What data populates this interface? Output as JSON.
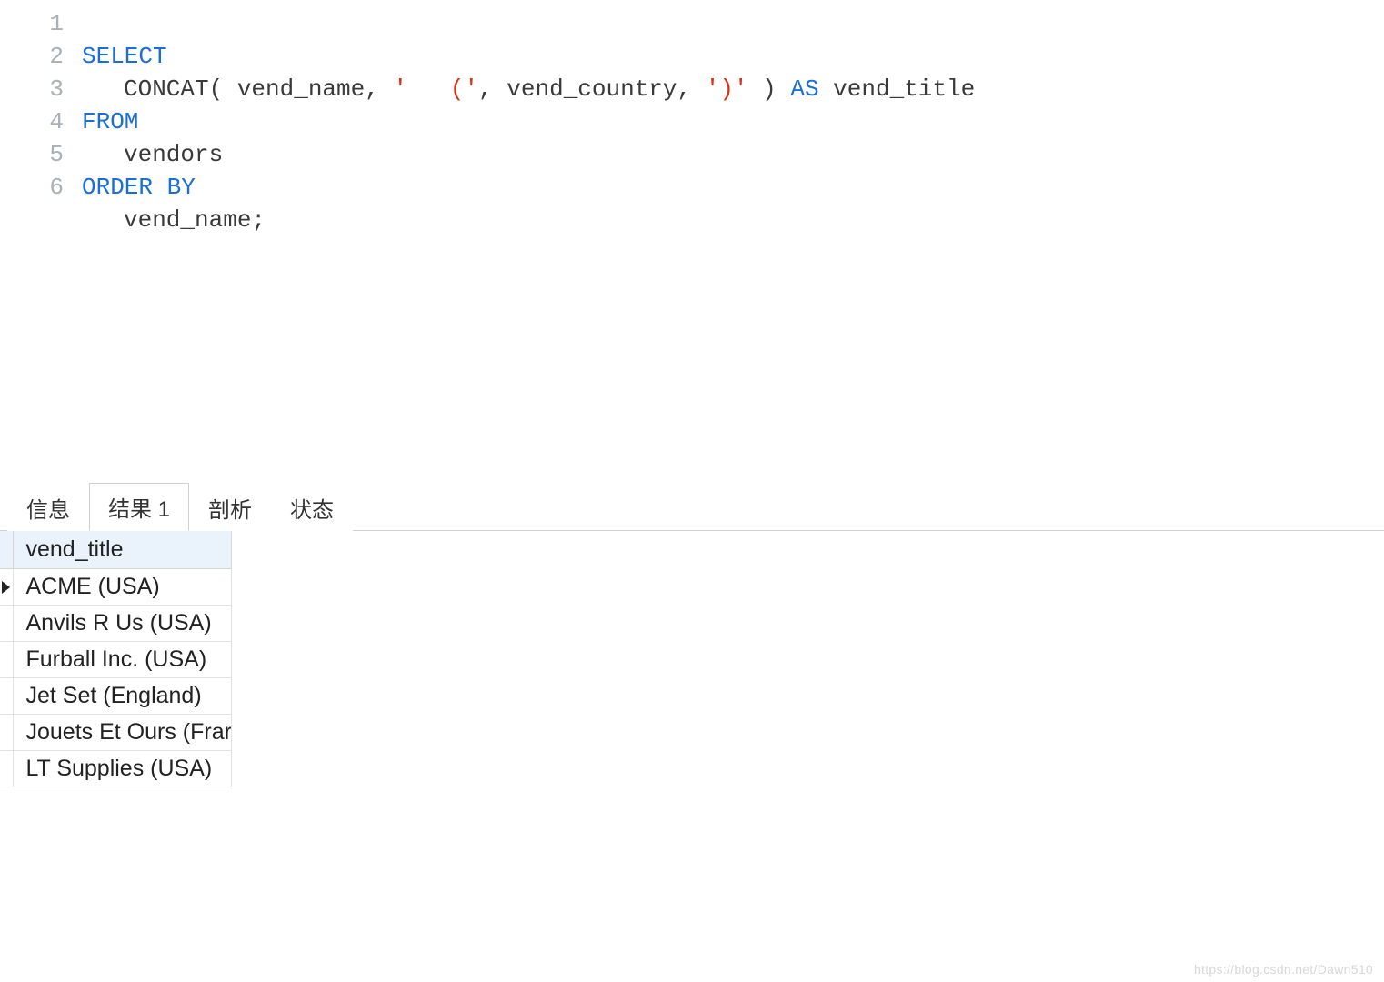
{
  "editor": {
    "lineNumbers": [
      "1",
      "2",
      "3",
      "4",
      "5",
      "6"
    ],
    "tokens": {
      "select": "SELECT",
      "concat": "CONCAT( vend_name, ",
      "str1": "'   ('",
      "comma1": ", vend_country, ",
      "str2": "')'",
      "close": " ) ",
      "as": "AS",
      "alias": " vend_title",
      "from": "FROM",
      "table": "vendors",
      "orderby": "ORDER BY",
      "ordercol": "vend_name;"
    }
  },
  "tabs": {
    "info": "信息",
    "result": "结果 1",
    "analysis": "剖析",
    "status": "状态"
  },
  "results": {
    "header": "vend_title",
    "rows": [
      "ACME   (USA)",
      "Anvils R Us   (USA)",
      "Furball Inc.   (USA)",
      "Jet Set   (England)",
      "Jouets Et Ours   (Frar",
      "LT Supplies   (USA)"
    ]
  },
  "watermark": "https://blog.csdn.net/Dawn510"
}
